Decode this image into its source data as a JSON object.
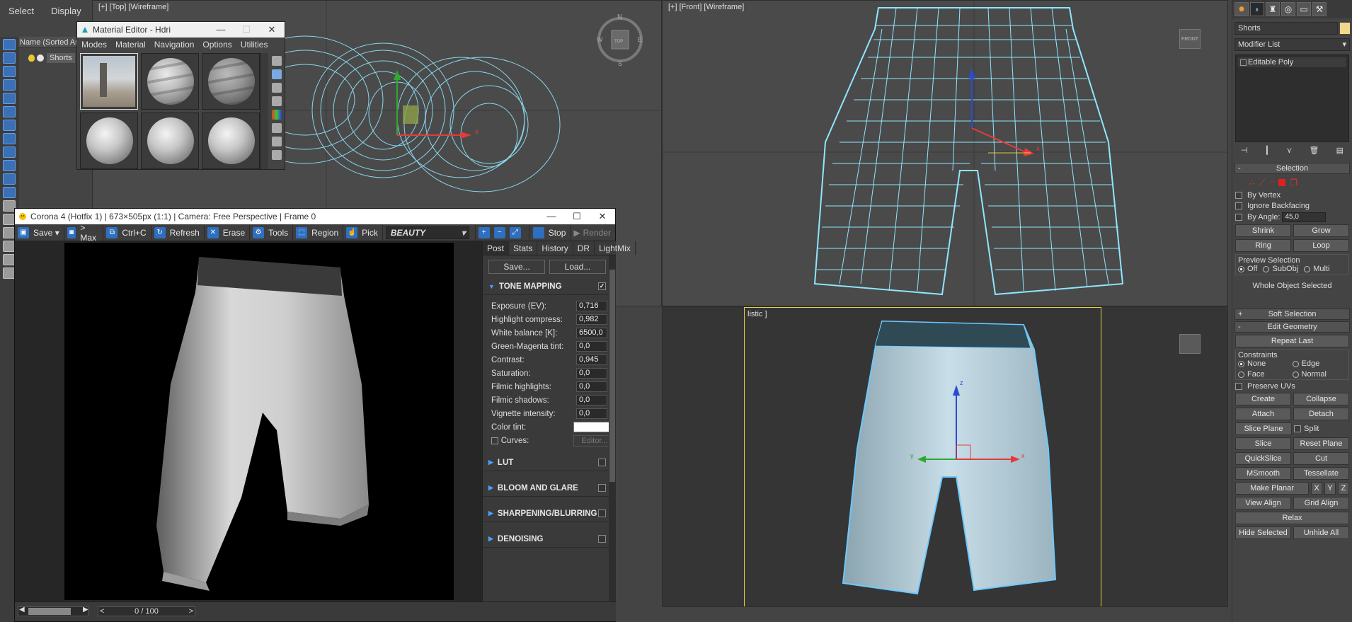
{
  "scene_explorer": {
    "menu": [
      "Select",
      "Display"
    ],
    "header": "Name (Sorted Ascending)",
    "object": "Shorts"
  },
  "viewports": {
    "top_label": "[+] [Top] [Wireframe]",
    "front_label": "[+] [Front] [Wireframe]",
    "persp_label": "listic ]",
    "compass": {
      "n": "N",
      "s": "S",
      "e": "E",
      "w": "W",
      "center": "TOP"
    },
    "front_cube": "FRONT",
    "axis_x": "x",
    "axis_y": "y",
    "axis_z": "z"
  },
  "material_editor": {
    "title": "Material Editor - Hdri",
    "menu": [
      "Modes",
      "Material",
      "Navigation",
      "Options",
      "Utilities"
    ]
  },
  "vfb": {
    "title": "Corona 4 (Hotfix 1) | 673×505px (1:1) | Camera: Free Perspective | Frame 0",
    "toolbar": {
      "save": "Save",
      "to_max": "> Max",
      "copy": "Ctrl+C",
      "refresh": "Refresh",
      "erase": "Erase",
      "tools": "Tools",
      "region": "Region",
      "pick": "Pick",
      "pass": "BEAUTY",
      "stop": "Stop",
      "render": "Render"
    },
    "tabs": [
      "Post",
      "Stats",
      "History",
      "DR",
      "LightMix"
    ],
    "save_btn": "Save...",
    "load_btn": "Load...",
    "tone_mapping": "TONE MAPPING",
    "params": [
      {
        "label": "Exposure (EV):",
        "value": "0,716"
      },
      {
        "label": "Highlight compress:",
        "value": "0,982"
      },
      {
        "label": "White balance [K]:",
        "value": "6500,0"
      },
      {
        "label": "Green-Magenta tint:",
        "value": "0,0"
      },
      {
        "label": "Contrast:",
        "value": "0,945"
      },
      {
        "label": "Saturation:",
        "value": "0,0"
      },
      {
        "label": "Filmic highlights:",
        "value": "0,0"
      },
      {
        "label": "Filmic shadows:",
        "value": "0,0"
      },
      {
        "label": "Vignette intensity:",
        "value": "0,0"
      }
    ],
    "color_tint": "Color tint:",
    "curves": "Curves:",
    "editor_btn": "Editor...",
    "sections": [
      "LUT",
      "BLOOM AND GLARE",
      "SHARPENING/BLURRING",
      "DENOISING"
    ],
    "frame_counter": "0 / 100"
  },
  "command_panel": {
    "object_name": "Shorts",
    "modifier_list": "Modifier List",
    "stack_item": "Editable Poly",
    "selection": {
      "title": "Selection",
      "by_vertex": "By Vertex",
      "ignore_backfacing": "Ignore Backfacing",
      "by_angle": "By Angle:",
      "angle_value": "45,0",
      "shrink": "Shrink",
      "grow": "Grow",
      "ring": "Ring",
      "loop": "Loop",
      "preview_title": "Preview Selection",
      "preview_off": "Off",
      "preview_subobj": "SubObj",
      "preview_multi": "Multi",
      "status": "Whole Object Selected"
    },
    "soft_selection": "Soft Selection",
    "edit_geometry": {
      "title": "Edit Geometry",
      "repeat_last": "Repeat Last",
      "constraints": "Constraints",
      "none": "None",
      "edge": "Edge",
      "face": "Face",
      "normal": "Normal",
      "preserve_uvs": "Preserve UVs",
      "create": "Create",
      "collapse": "Collapse",
      "attach": "Attach",
      "detach": "Detach",
      "slice_plane": "Slice Plane",
      "split": "Split",
      "slice": "Slice",
      "reset_plane": "Reset Plane",
      "quickslice": "QuickSlice",
      "cut": "Cut",
      "msmooth": "MSmooth",
      "tessellate": "Tessellate",
      "make_planar": "Make Planar",
      "x": "X",
      "y": "Y",
      "z": "Z",
      "view_align": "View Align",
      "grid_align": "Grid Align",
      "relax": "Relax",
      "hide_selected": "Hide Selected",
      "unhide_all": "Unhide All"
    }
  },
  "colors": {
    "wireframe": "#8fe6ff",
    "selection_frame": "#e6d23c",
    "accent_blue": "#2f6fc0"
  }
}
